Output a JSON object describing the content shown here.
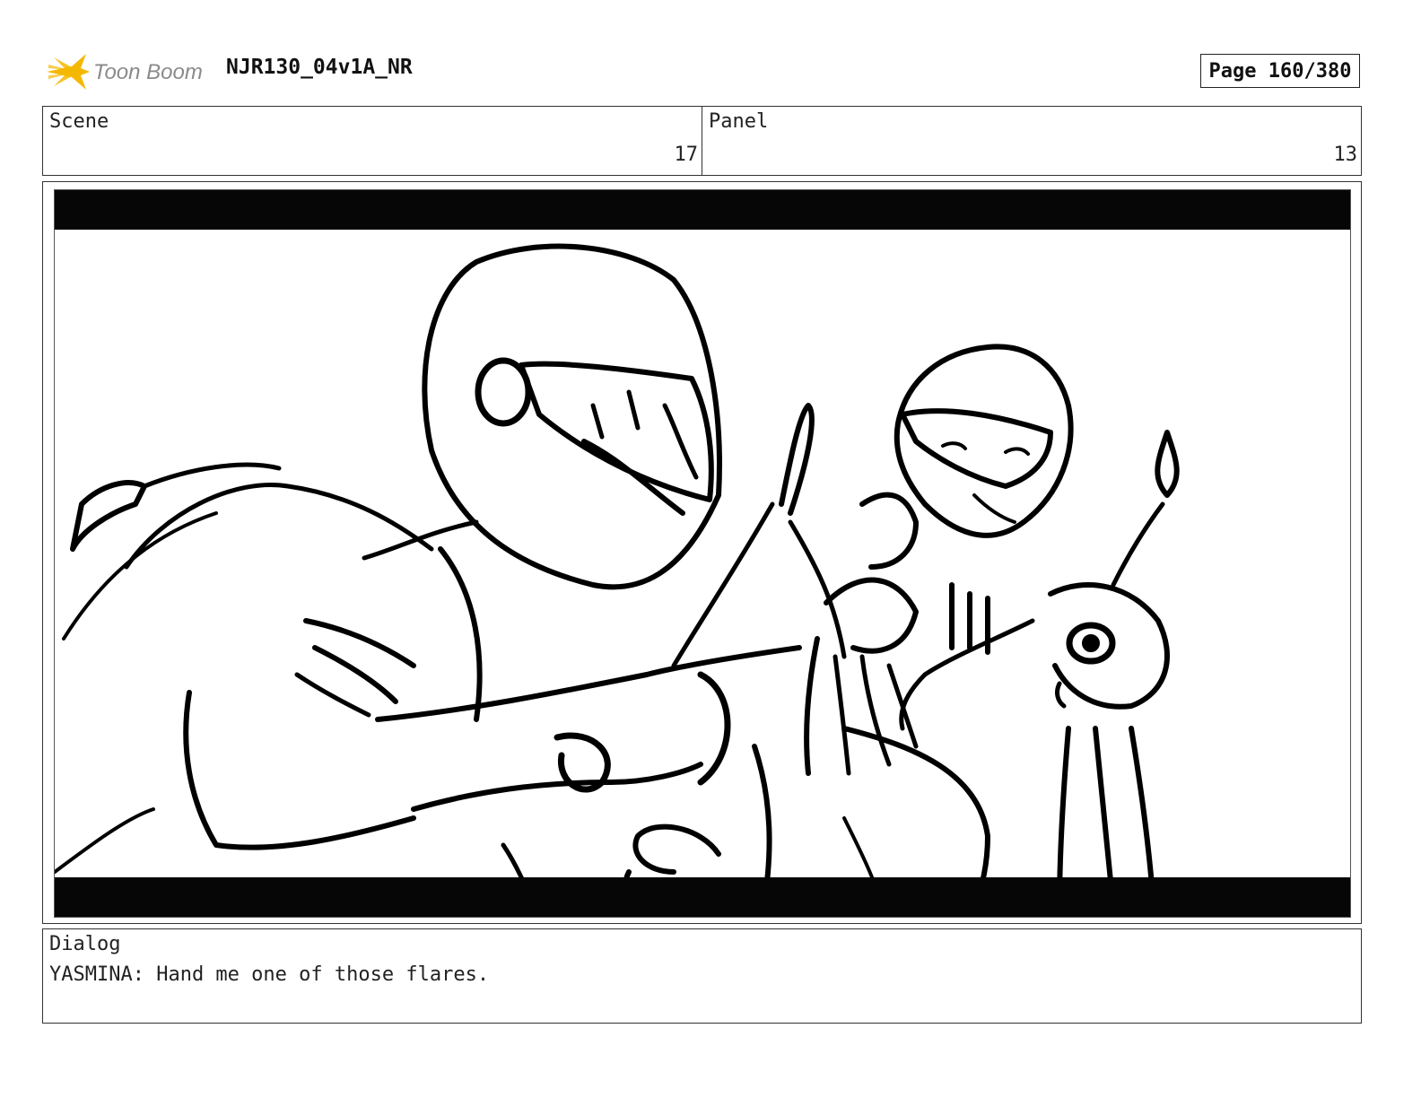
{
  "header": {
    "logo_text": "Toon Boom",
    "logo_icon": "sunburst-star-icon",
    "document_title": "NJR130_04v1A_NR",
    "page_indicator": "Page 160/380"
  },
  "info": {
    "scene_label": "Scene",
    "scene_value": "17",
    "panel_label": "Panel",
    "panel_value": "13"
  },
  "panel_image": {
    "description_icon": "storyboard-sketch",
    "letterbox_color": "#060606"
  },
  "dialog": {
    "label": "Dialog",
    "text": "YASMINA: Hand me one of those flares."
  },
  "colors": {
    "logo_star": "#f5b800",
    "logo_text": "#8a8a8a",
    "border": "#333333"
  }
}
